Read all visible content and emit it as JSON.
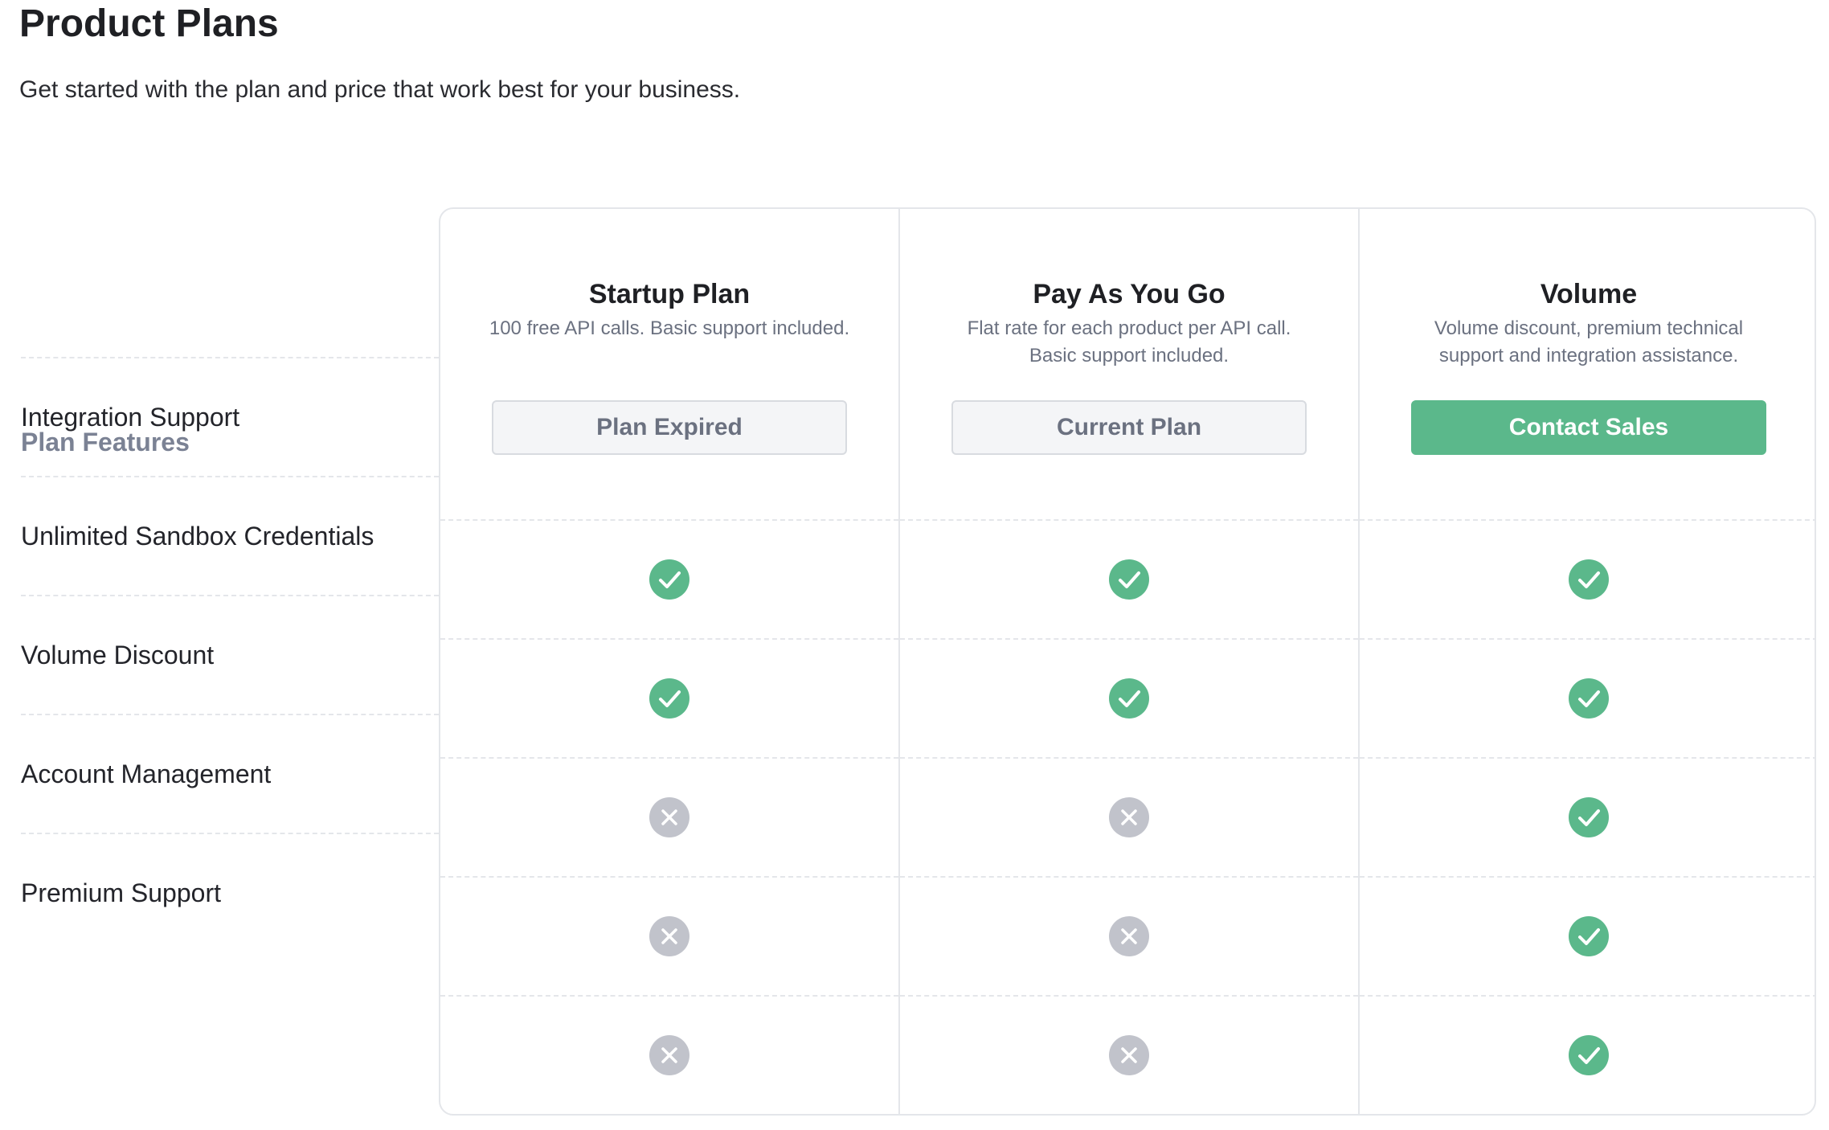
{
  "page": {
    "title": "Product Plans",
    "subtitle": "Get started with the plan and price that work best for your business."
  },
  "features": {
    "heading": "Plan Features",
    "items": [
      "Integration Support",
      "Unlimited Sandbox Credentials",
      "Volume Discount",
      "Account Management",
      "Premium Support"
    ]
  },
  "plans": [
    {
      "name": "Startup Plan",
      "description": "100 free API calls. Basic support included.",
      "button_label": "Plan Expired",
      "button_style": "disabled",
      "features": [
        "check-icon",
        "check-icon",
        "x-icon",
        "x-icon",
        "x-icon"
      ]
    },
    {
      "name": "Pay As You Go",
      "description": "Flat rate for each product per API call. Basic support included.",
      "button_label": "Current Plan",
      "button_style": "disabled",
      "features": [
        "check-icon",
        "check-icon",
        "x-icon",
        "x-icon",
        "x-icon"
      ]
    },
    {
      "name": "Volume",
      "description": "Volume discount, premium technical support and integration assistance.",
      "button_label": "Contact Sales",
      "button_style": "primary",
      "features": [
        "check-icon",
        "check-icon",
        "check-icon",
        "check-icon",
        "check-icon"
      ]
    }
  ],
  "colors": {
    "accent": "#5bb88b",
    "check": "#5bb88b",
    "x": "#c1c3cb",
    "muted_text": "#7b8294",
    "border": "#e4e6ea"
  }
}
